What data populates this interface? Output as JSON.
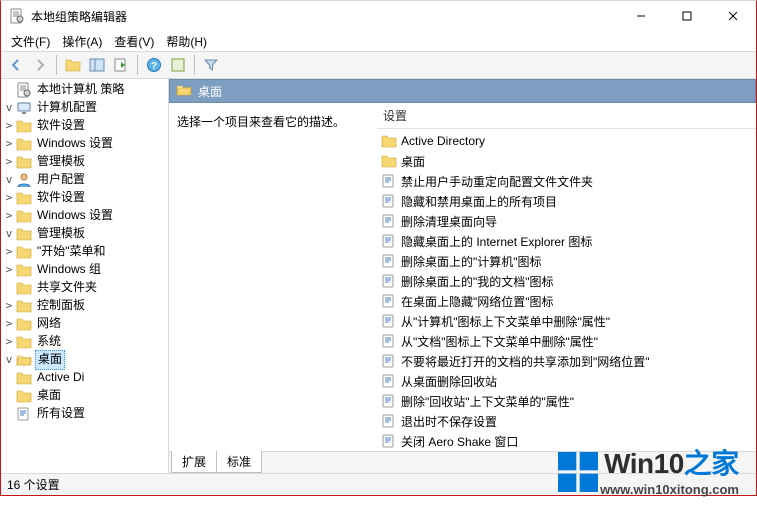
{
  "window": {
    "title": "本地组策略编辑器"
  },
  "menu": {
    "file": "文件(F)",
    "action": "操作(A)",
    "view": "查看(V)",
    "help": "帮助(H)"
  },
  "tree": {
    "root": "本地计算机 策略",
    "computer_config": "计算机配置",
    "software_settings_1": "软件设置",
    "windows_settings_1": "Windows 设置",
    "admin_templates_1": "管理模板",
    "user_config": "用户配置",
    "software_settings_2": "软件设置",
    "windows_settings_2": "Windows 设置",
    "admin_templates_2": "管理模板",
    "start_menu": "\"开始\"菜单和",
    "windows_comp": "Windows 组",
    "shared_folders": "共享文件夹",
    "control_panel": "控制面板",
    "network": "网络",
    "system": "系统",
    "desktop": "桌面",
    "active_directory": "Active Di",
    "desktop_sub": "桌面",
    "all_settings": "所有设置"
  },
  "header": {
    "label": "桌面"
  },
  "desc": {
    "prompt": "选择一个项目来查看它的描述。"
  },
  "list": {
    "column": "设置",
    "items": [
      "Active Directory",
      "桌面",
      "禁止用户手动重定向配置文件文件夹",
      "隐藏和禁用桌面上的所有项目",
      "删除清理桌面向导",
      "隐藏桌面上的 Internet Explorer 图标",
      "删除桌面上的\"计算机\"图标",
      "删除桌面上的\"我的文档\"图标",
      "在桌面上隐藏\"网络位置\"图标",
      "从\"计算机\"图标上下文菜单中删除\"属性\"",
      "从\"文档\"图标上下文菜单中删除\"属性\"",
      "不要将最近打开的文档的共享添加到\"网络位置\"",
      "从桌面删除回收站",
      "删除\"回收站\"上下文菜单的\"属性\"",
      "退出时不保存设置",
      "关闭 Aero Shake 窗口"
    ]
  },
  "tabs": {
    "ext": "扩展",
    "std": "标准"
  },
  "status": {
    "count": "16 个设置"
  },
  "watermark": {
    "brand": "Win10",
    "suffix": "之家",
    "url": "www.win10xitong.com"
  }
}
